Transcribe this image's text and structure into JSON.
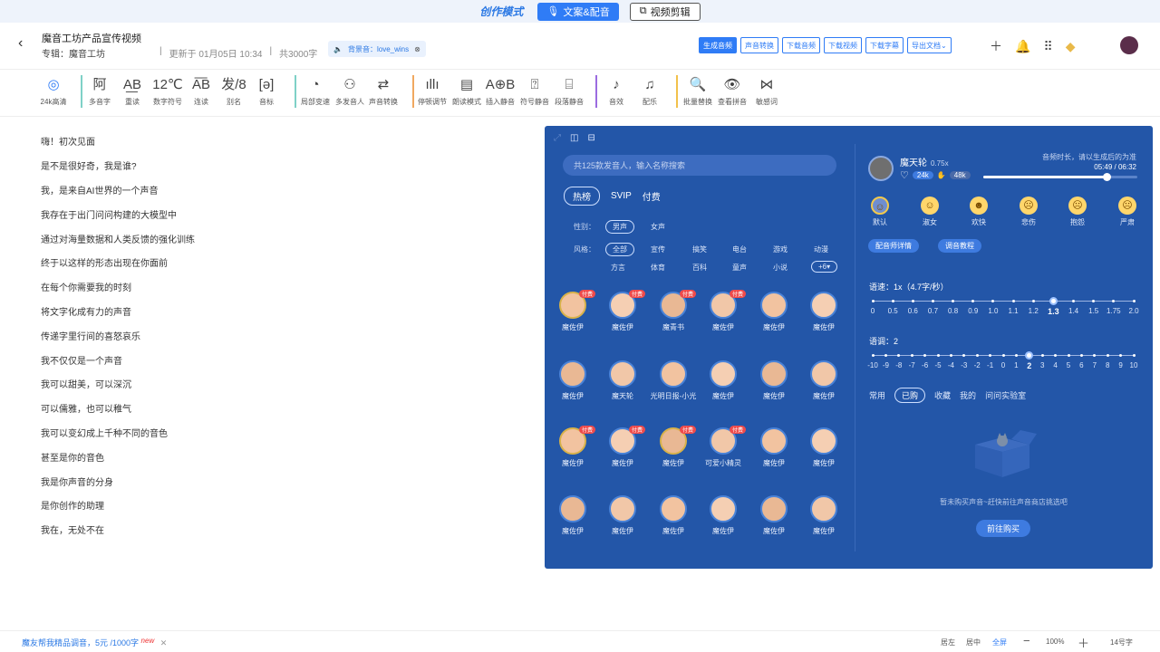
{
  "topbar": {
    "brand": "创作模式",
    "tab_copy": "文案&配音",
    "tab_video": "视频剪辑"
  },
  "header": {
    "title": "魔音工坊产品宣传视频",
    "album": "专辑：魔音工坊",
    "updated": "更新于 01月05日 10:34",
    "count": "共3000字",
    "bgm": "背景音：love_wins",
    "buttons": [
      "生成音频",
      "声音转换",
      "下载音频",
      "下载视频",
      "下载字幕",
      "导出文档"
    ]
  },
  "toolbar": {
    "tools": [
      "24k高清",
      "多音字",
      "重读",
      "数字符号",
      "连读",
      "别名",
      "音标",
      "局部变速",
      "多发音人",
      "声音转换",
      "停顿调节",
      "朗读模式",
      "插入静音",
      "符号静音",
      "段落静音",
      "音效",
      "配乐",
      "批量替换",
      "查看拼音",
      "敏感词"
    ],
    "tool_icons": [
      "◎",
      "阿",
      "A͟B",
      "12℃",
      "A͞B",
      "发/8",
      "[ə]",
      "◔",
      "⚇",
      "⇄",
      "ıllı",
      "▤",
      "A⊕B",
      "⍰",
      "⌸",
      "♪",
      "♫",
      "🔍",
      "👁",
      "⋈"
    ],
    "sample_labels": {
      "polyphone": "阿",
      "stress": "AB",
      "digits": "12℃",
      "liaison": "AB",
      "alias": "发8",
      "ipa": "[ə]",
      "insert": "A+B"
    }
  },
  "editor": {
    "lines": [
      "嗨！初次见面",
      "是不是很好奇，我是谁?",
      "我，是来自AI世界的一个声音",
      "我存在于出门问问构建的大模型中",
      "通过对海量数据和人类反馈的强化训练",
      "终于以这样的形态出现在你面前",
      "在每个你需要我的时刻",
      "将文字化成有力的声音",
      "传递字里行间的喜怒哀乐",
      "我不仅仅是一个声音",
      "我可以甜美，可以深沉",
      "可以儒雅，也可以稚气",
      "我可以变幻成上千种不同的音色",
      "甚至是你的音色",
      "我是你声音的分身",
      "是你创作的助理",
      "我在，无处不在"
    ]
  },
  "panel": {
    "search_placeholder": "共125款发音人，输入名称搜索",
    "tabs": [
      "热榜",
      "SVIP",
      "付费"
    ],
    "gender_label": "性别：",
    "genders": [
      "男声",
      "女声"
    ],
    "style_label": "风格：",
    "styles_row1": [
      "全部",
      "宣传",
      "搞笑",
      "电台",
      "游戏",
      "动漫"
    ],
    "styles_row2": [
      "方言",
      "体育",
      "百科",
      "童声",
      "小说",
      "+6▾"
    ],
    "paid_badge": "付费",
    "voices": [
      "魔佐伊",
      "魔佐伊",
      "魔青书",
      "魔佐伊",
      "魔佐伊",
      "魔佐伊",
      "魔佐伊",
      "魔天轮",
      "光明日报-小光",
      "魔佐伊",
      "魔佐伊",
      "魔佐伊",
      "魔佐伊",
      "魔佐伊",
      "魔佐伊",
      "可爱小精灵",
      "魔佐伊",
      "魔佐伊",
      "魔佐伊",
      "魔佐伊",
      "魔佐伊",
      "魔佐伊",
      "魔佐伊",
      "魔佐伊"
    ],
    "current": {
      "name": "魔天轮",
      "speed": "0.75x",
      "tag1": "24k",
      "tag2": "48k",
      "tip": "音频时长，请以生成后的为准",
      "time": "05:49 / 06:32",
      "progress": 0.8
    },
    "emotions": [
      "默认",
      "淑女",
      "欢快",
      "悲伤",
      "抱怨",
      "严肃"
    ],
    "detail_btn": "配音师详情",
    "tutorial_btn": "调音教程",
    "speed_label": "语速：1x（4.7字/秒）",
    "speed_ticks": [
      "0",
      "0.5",
      "0.6",
      "0.7",
      "0.8",
      "0.9",
      "1.0",
      "1.1",
      "1.2",
      "1.3",
      "1.4",
      "1.5",
      "1.75",
      "2.0"
    ],
    "speed_value": "1.3",
    "pitch_label": "语调：2",
    "pitch_ticks": [
      "-10",
      "-9",
      "-8",
      "-7",
      "-6",
      "-5",
      "-4",
      "-3",
      "-2",
      "-1",
      "0",
      "1",
      "2",
      "3",
      "4",
      "5",
      "6",
      "7",
      "8",
      "9",
      "10"
    ],
    "pitch_value": "2",
    "categories": [
      "常用",
      "已购",
      "收藏",
      "我的",
      "问问实验室"
    ],
    "empty_text": "暂未购买声音~赶快前往声音商店挑选吧",
    "buy_btn": "前往购买"
  },
  "status": {
    "promo": "魔友帮我精品调音，5元 /1000字",
    "new": "new",
    "align": [
      "居左",
      "居中",
      "全屏"
    ],
    "zoom": "100%",
    "font_size": "14号字"
  },
  "colors": {
    "accent": "#2f7cf6",
    "panel": "#2356a8"
  }
}
